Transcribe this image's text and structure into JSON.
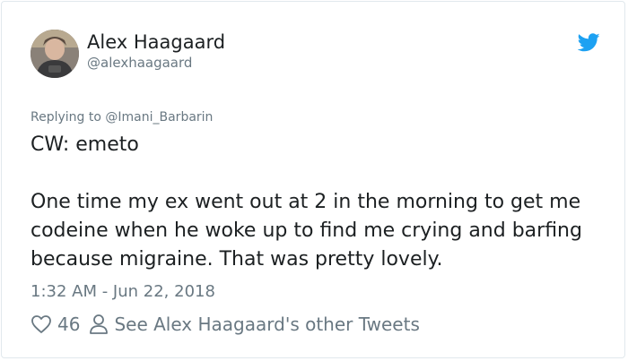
{
  "tweet": {
    "author_name": "Alex Haagaard",
    "author_handle": "@alexhaagaard",
    "reply_prefix": "Replying to ",
    "reply_to": "@Imani_Barbarin",
    "body_line1": "CW: emeto",
    "body_line2": "One time my ex went out at 2 in the morning to get me codeine when he woke up to find me crying and barfing because migraine. That was pretty lovely.",
    "timestamp": "1:32 AM - Jun 22, 2018",
    "likes": "46",
    "other_tweets_label": "See Alex Haagaard's other Tweets"
  },
  "icons": {
    "logo": "twitter-bird-icon",
    "like": "heart-icon",
    "profile": "person-icon"
  },
  "colors": {
    "brand_blue": "#1da1f2",
    "text": "#1c2022",
    "muted": "#697882",
    "border": "#e1e8ed"
  }
}
